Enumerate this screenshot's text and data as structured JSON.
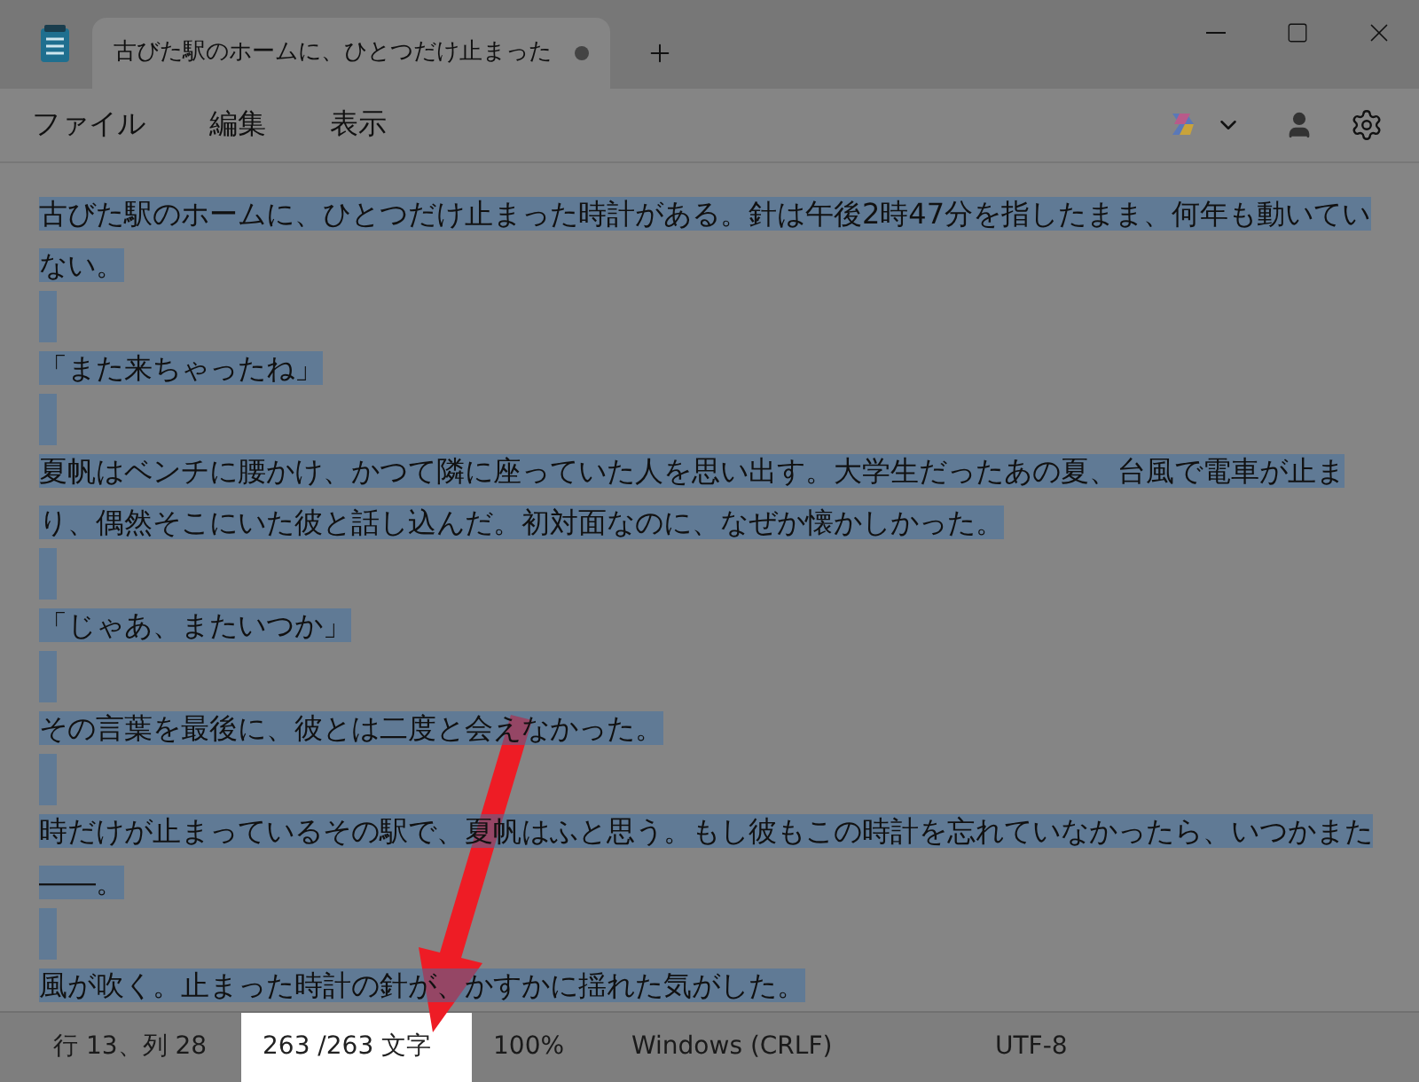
{
  "window": {
    "tab": {
      "title": "古びた駅のホームに、ひとつだけ止まった",
      "modified": true,
      "selected": true
    }
  },
  "menu": [
    {
      "label": "ファイル"
    },
    {
      "label": "編集"
    },
    {
      "label": "表示"
    }
  ],
  "editor": {
    "selected": true,
    "paragraphs": [
      "古びた駅のホームに、ひとつだけ止まった時計がある。針は午後2時47分を指したまま、何年も動いていない。",
      "「また来ちゃったね」",
      "夏帆はベンチに腰かけ、かつて隣に座っていた人を思い出す。大学生だったあの夏、台風で電車が止まり、偶然そこにいた彼と話し込んだ。初対面なのに、なぜか懐かしかった。",
      "「じゃあ、またいつか」",
      "その言葉を最後に、彼とは二度と会えなかった。",
      "時だけが止まっているその駅で、夏帆はふと思う。もし彼もこの時計を忘れていなかったら、いつかまた――。",
      "風が吹く。止まった時計の針が、かすかに揺れた気がした。"
    ]
  },
  "status_bar": [
    {
      "text": "行 13、列 28",
      "highlighted": false
    },
    {
      "text": "263 /263 文字",
      "highlighted": true
    },
    {
      "text": "100%",
      "highlighted": false
    },
    {
      "text": "Windows (CRLF)",
      "highlighted": false
    },
    {
      "text": "UTF-8",
      "highlighted": false
    }
  ]
}
